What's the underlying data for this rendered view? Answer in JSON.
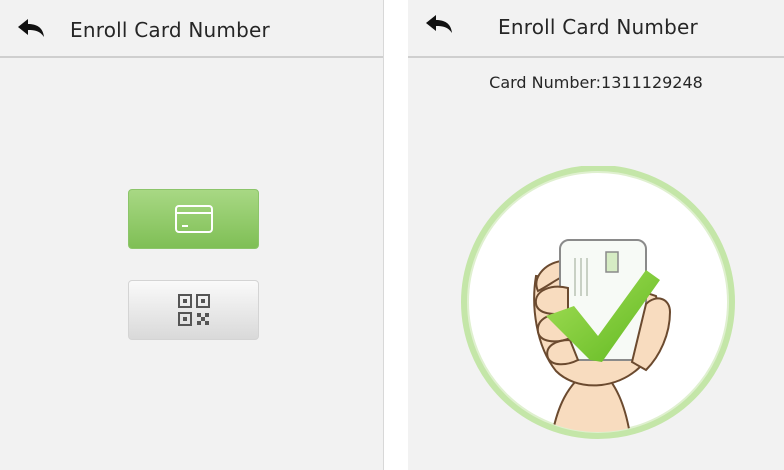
{
  "left_screen": {
    "title": "Enroll Card Number",
    "back_icon": "back-arrow-icon",
    "buttons": [
      {
        "name": "card",
        "icon": "card-icon",
        "color": "#7fbf55"
      },
      {
        "name": "qr-code",
        "icon": "qr-code-icon",
        "color": "#e2e2e2"
      }
    ]
  },
  "right_screen": {
    "title": "Enroll Card Number",
    "back_icon": "back-arrow-icon",
    "card_number": "Card Number:1311129248",
    "illustration": "hand-holding-card-success-icon",
    "accent_color": "#8bd040"
  }
}
